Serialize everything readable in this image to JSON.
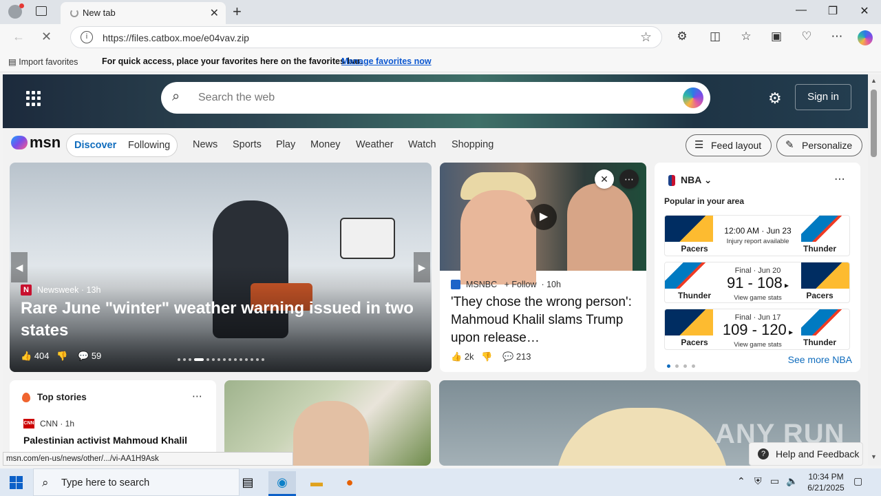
{
  "browser": {
    "tab_title": "New tab",
    "url": "https://files.catbox.moe/e04vav.zip",
    "favorites": {
      "import_label": "Import favorites",
      "message": "For quick access, place your favorites here on the favorites bar.",
      "link": "Manage favorites now"
    }
  },
  "msn": {
    "search_placeholder": "Search the web",
    "sign_in": "Sign in",
    "logo": "msn",
    "segments": [
      "Discover",
      "Following"
    ],
    "nav": [
      "News",
      "Sports",
      "Play",
      "Money",
      "Weather",
      "Watch",
      "Shopping"
    ],
    "feed_layout": "Feed layout",
    "personalize": "Personalize"
  },
  "lead_story": {
    "source": "Newsweek · 13h",
    "headline": "Rare June \"winter\" weather warning issued in two states",
    "likes": "404",
    "comments": "59"
  },
  "story2": {
    "source": "MSNBC",
    "follow": "+ Follow",
    "age": "· 10h",
    "headline": "'They chose the wrong person': Mahmoud Khalil slams Trump upon release…",
    "likes": "2k",
    "comments": "213"
  },
  "nba": {
    "title": "NBA",
    "popular": "Popular in your area",
    "games": [
      {
        "left": "Pacers",
        "right": "Thunder",
        "line1": "12:00 AM · Jun 23",
        "line2": "Injury report available",
        "score": ""
      },
      {
        "left": "Thunder",
        "right": "Pacers",
        "line1": "Final · Jun 20",
        "score": "91 - 108",
        "line2": "View game stats"
      },
      {
        "left": "Pacers",
        "right": "Thunder",
        "line1": "Final · Jun 17",
        "score": "109 - 120",
        "line2": "View game stats"
      }
    ],
    "see_more": "See more NBA"
  },
  "top_stories": {
    "title": "Top stories",
    "source": "CNN · 1h",
    "headline": "Palestinian activist Mahmoud Khalil"
  },
  "help": "Help and Feedback",
  "watermark": "ANY RUN",
  "status_url": "msn.com/en-us/news/other/.../vi-AA1H9Ask",
  "taskbar": {
    "search": "Type here to search",
    "time": "10:34 PM",
    "date": "6/21/2025"
  }
}
